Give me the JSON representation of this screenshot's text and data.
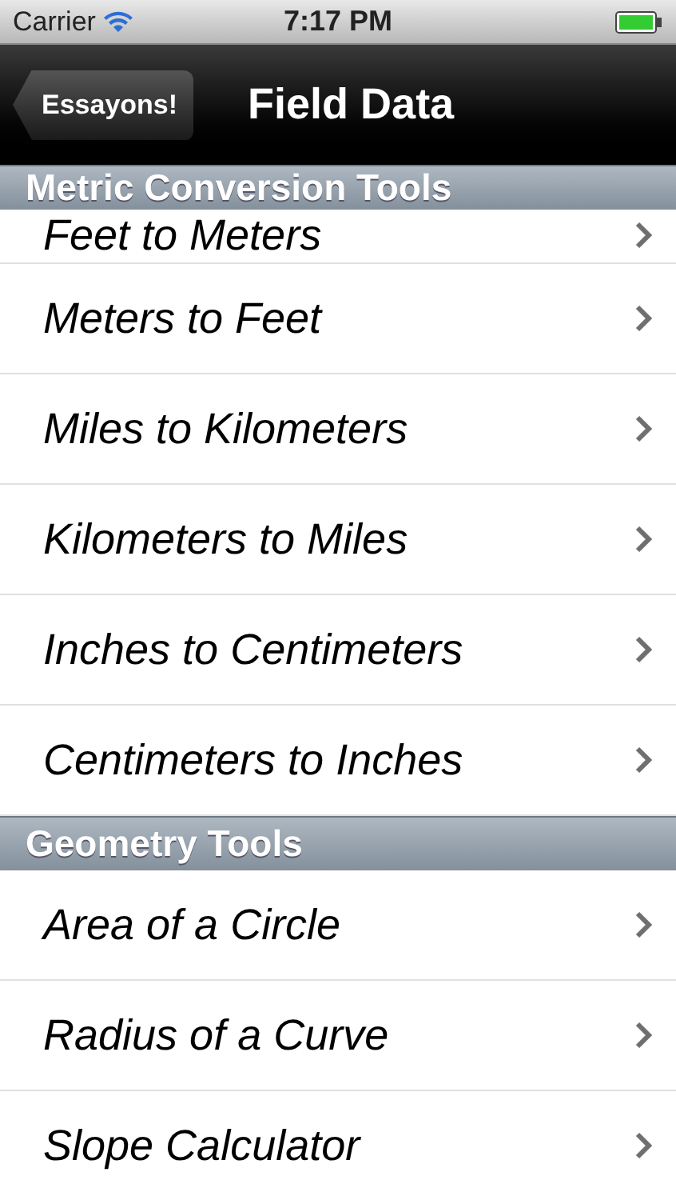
{
  "status_bar": {
    "carrier": "Carrier",
    "time": "7:17 PM"
  },
  "nav_bar": {
    "back_button": "Essayons!",
    "title": "Field Data"
  },
  "sections": [
    {
      "title": "Metric Conversion Tools",
      "rows": [
        {
          "label": "Feet to Meters"
        },
        {
          "label": "Meters to Feet"
        },
        {
          "label": "Miles to Kilometers"
        },
        {
          "label": "Kilometers to Miles"
        },
        {
          "label": "Inches to Centimeters"
        },
        {
          "label": "Centimeters to Inches"
        }
      ]
    },
    {
      "title": "Geometry Tools",
      "rows": [
        {
          "label": "Area of a Circle"
        },
        {
          "label": "Radius of a Curve"
        },
        {
          "label": "Slope Calculator"
        }
      ]
    }
  ]
}
